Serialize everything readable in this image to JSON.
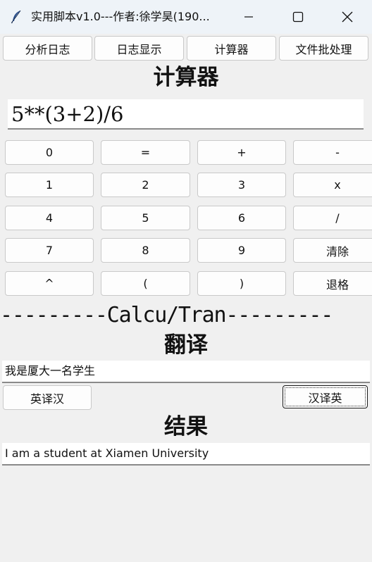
{
  "window": {
    "title": "实用脚本v1.0---作者:徐学昊(190...",
    "icon": "feather-icon"
  },
  "tabs": [
    "分析日志",
    "日志显示",
    "计算器",
    "文件批处理"
  ],
  "calculator": {
    "heading": "计算器",
    "expression": "5**(3+2)/6",
    "keys": [
      [
        "0",
        "=",
        "+",
        "-"
      ],
      [
        "1",
        "2",
        "3",
        "x"
      ],
      [
        "4",
        "5",
        "6",
        "/"
      ],
      [
        "7",
        "8",
        "9",
        "清除"
      ],
      [
        "^",
        "(",
        ")",
        "退格"
      ]
    ]
  },
  "separator": "---------Calcu/Tran---------",
  "translate": {
    "heading": "翻译",
    "input": "我是厦大一名学生",
    "en_to_zh_label": "英译汉",
    "zh_to_en_label": "汉译英"
  },
  "result": {
    "heading": "结果",
    "output": "I am a student at Xiamen University"
  }
}
